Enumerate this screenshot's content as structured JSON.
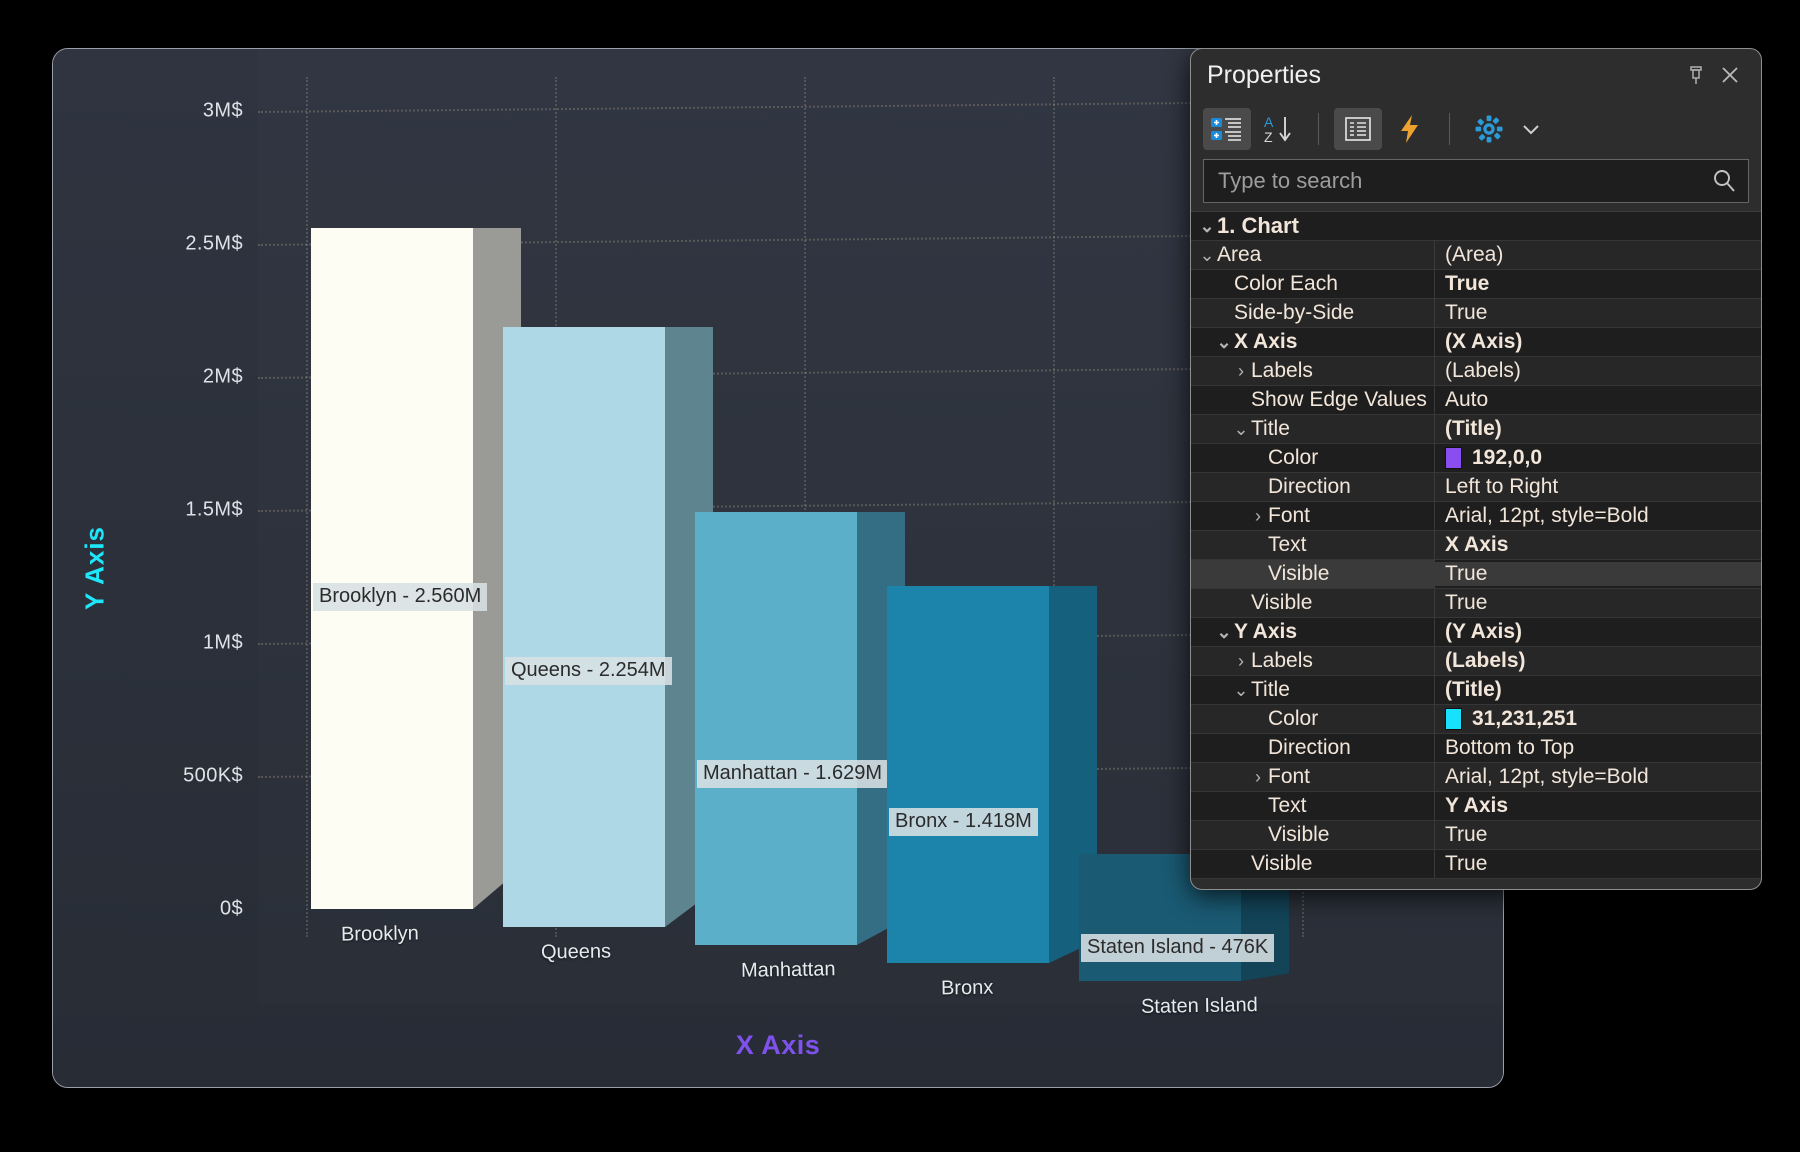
{
  "chart_data": {
    "type": "bar",
    "title": "",
    "xlabel": "X Axis",
    "ylabel": "Y Axis",
    "categories": [
      "Brooklyn",
      "Queens",
      "Manhattan",
      "Bronx",
      "Staten Island"
    ],
    "values": [
      2560000,
      2254000,
      1629000,
      1418000,
      476000
    ],
    "value_labels": [
      "Brooklyn - 2.560M",
      "Queens - 2.254M",
      "Manhattan - 1.629M",
      "Bronx - 1.418M",
      "Staten Island - 476K"
    ],
    "ylim": [
      0,
      3000000
    ],
    "ytick_labels": [
      "3M$",
      "2.5M$",
      "2M$",
      "1.5M$",
      "1M$",
      "500K$",
      "0$"
    ],
    "ytick_values": [
      3000000,
      2500000,
      2000000,
      1500000,
      1000000,
      500000,
      0
    ],
    "grid": true,
    "legend": "none",
    "bar_colors": [
      "#fdfdf3",
      "#aed8e6",
      "#5cafc8",
      "#1c84ab",
      "#1a5a73"
    ],
    "bar_side_colors": [
      "#9a9a96",
      "#5e8490",
      "#336e84",
      "#15607c",
      "#134458"
    ],
    "x_title_color": "#7f52ee",
    "y_title_color": "#1fe7fb",
    "axis_label_color": "#e8ebee",
    "plot_background": "#2d323c"
  },
  "properties_panel": {
    "title": "Properties",
    "pin_icon": "pin-icon",
    "close_icon": "close-icon",
    "toolbar": [
      {
        "name": "categorized-button",
        "icon": "categorized-icon",
        "active": true
      },
      {
        "name": "alphabetical-button",
        "icon": "sort-az-icon",
        "active": false
      },
      {
        "name": "separator-1",
        "icon": "separator",
        "active": false
      },
      {
        "name": "property-pages-button",
        "icon": "property-pages-icon",
        "active": true
      },
      {
        "name": "events-button",
        "icon": "lightning-icon",
        "active": false
      },
      {
        "name": "separator-2",
        "icon": "separator",
        "active": false
      },
      {
        "name": "settings-button",
        "icon": "gear-icon",
        "active": false
      },
      {
        "name": "settings-dropdown",
        "icon": "chevron-down-icon",
        "active": false
      }
    ],
    "search": {
      "placeholder": "Type to search",
      "value": "",
      "icon": "search-icon"
    },
    "rows": [
      {
        "indent": 0,
        "expander": "down",
        "name": "1. Chart",
        "value": "",
        "header": true
      },
      {
        "indent": 0,
        "expander": "down",
        "name": "Area",
        "value": "(Area)"
      },
      {
        "indent": 1,
        "expander": "none",
        "name": "Color Each",
        "value": "True",
        "valbold": true
      },
      {
        "indent": 1,
        "expander": "none",
        "name": "Side-by-Side",
        "value": "True"
      },
      {
        "indent": 1,
        "expander": "down",
        "name": "X Axis",
        "value": "(X Axis)",
        "bold": true
      },
      {
        "indent": 2,
        "expander": "right",
        "name": "Labels",
        "value": "(Labels)"
      },
      {
        "indent": 2,
        "expander": "none",
        "name": "Show Edge Values",
        "value": "Auto"
      },
      {
        "indent": 2,
        "expander": "down",
        "name": "Title",
        "value": "(Title)",
        "valbold": true
      },
      {
        "indent": 3,
        "expander": "none",
        "name": "Color",
        "value": "192,0,0",
        "swatch": "#8a4df0",
        "valbold": true
      },
      {
        "indent": 3,
        "expander": "none",
        "name": "Direction",
        "value": "Left to Right"
      },
      {
        "indent": 3,
        "expander": "right",
        "name": "Font",
        "value": "Arial, 12pt, style=Bold"
      },
      {
        "indent": 3,
        "expander": "none",
        "name": "Text",
        "value": "X Axis",
        "valbold": true
      },
      {
        "indent": 3,
        "expander": "none",
        "name": "Visible",
        "value": "True",
        "selected": true
      },
      {
        "indent": 2,
        "expander": "none",
        "name": "Visible",
        "value": "True"
      },
      {
        "indent": 1,
        "expander": "down",
        "name": "Y Axis",
        "value": "(Y Axis)",
        "bold": true
      },
      {
        "indent": 2,
        "expander": "right",
        "name": "Labels",
        "value": "(Labels)",
        "valbold": true
      },
      {
        "indent": 2,
        "expander": "down",
        "name": "Title",
        "value": "(Title)",
        "valbold": true
      },
      {
        "indent": 3,
        "expander": "none",
        "name": "Color",
        "value": "31,231,251",
        "swatch": "#18e2fb",
        "valbold": true
      },
      {
        "indent": 3,
        "expander": "none",
        "name": "Direction",
        "value": "Bottom to Top"
      },
      {
        "indent": 3,
        "expander": "right",
        "name": "Font",
        "value": "Arial, 12pt, style=Bold"
      },
      {
        "indent": 3,
        "expander": "none",
        "name": "Text",
        "value": "Y Axis",
        "valbold": true
      },
      {
        "indent": 3,
        "expander": "none",
        "name": "Visible",
        "value": "True"
      },
      {
        "indent": 2,
        "expander": "none",
        "name": "Visible",
        "value": "True"
      }
    ]
  }
}
